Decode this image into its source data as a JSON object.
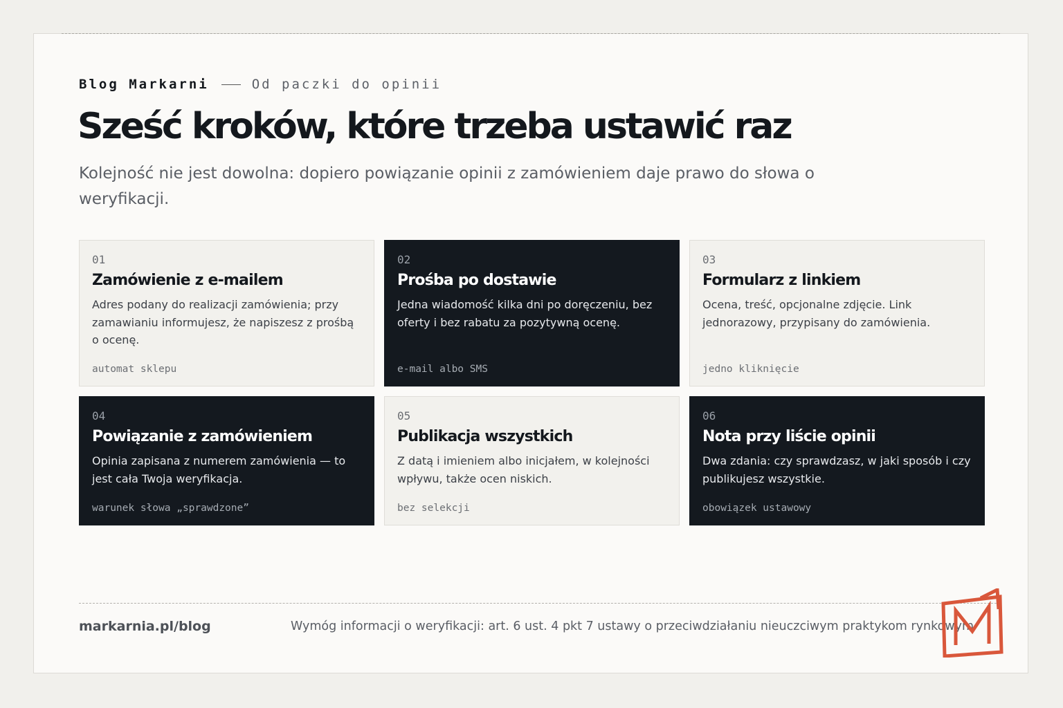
{
  "header": {
    "brand": "Blog Markarni",
    "series": "Od paczki do opinii"
  },
  "title": "Sześć kroków, które trzeba ustawić raz",
  "lead": "Kolejność nie jest dowolna: dopiero powiązanie opinii z zamówieniem daje prawo do słowa o weryfikacji.",
  "steps": [
    {
      "num": "01",
      "title": "Zamówienie z e-mailem",
      "desc": "Adres podany do realizacji zamówienia; przy zamawianiu informujesz, że napiszesz z prośbą o ocenę.",
      "tag": "automat sklepu",
      "theme": "light"
    },
    {
      "num": "02",
      "title": "Prośba po dostawie",
      "desc": "Jedna wiadomość kilka dni po doręczeniu, bez oferty i bez rabatu za pozytywną ocenę.",
      "tag": "e-mail albo SMS",
      "theme": "dark"
    },
    {
      "num": "03",
      "title": "Formularz z linkiem",
      "desc": "Ocena, treść, opcjonalne zdjęcie. Link jednorazowy, przypisany do zamówienia.",
      "tag": "jedno kliknięcie",
      "theme": "light"
    },
    {
      "num": "04",
      "title": "Powiązanie z zamówieniem",
      "desc": "Opinia zapisana z numerem zamówienia — to jest cała Twoja weryfikacja.",
      "tag": "warunek słowa „sprawdzone”",
      "theme": "dark"
    },
    {
      "num": "05",
      "title": "Publikacja wszystkich",
      "desc": "Z datą i imieniem albo inicjałem, w kolejności wpływu, także ocen niskich.",
      "tag": "bez selekcji",
      "theme": "light"
    },
    {
      "num": "06",
      "title": "Nota przy liście opinii",
      "desc": "Dwa zdania: czy sprawdzasz, w jaki sposób i czy publikujesz wszystkie.",
      "tag": "obowiązek ustawowy",
      "theme": "dark"
    }
  ],
  "footer": {
    "site": "markarnia.pl/blog",
    "note": "Wymóg informacji o weryfikacji: art. 6 ust. 4 pkt 7 ustawy o przeciwdziałaniu nieuczciwym praktykom rynkowym"
  },
  "colors": {
    "background": "#f1f0ec",
    "panel": "#fbfaf8",
    "card_light": "#f2f1ed",
    "card_dark": "#14191f",
    "text": "#14181d",
    "muted": "#5a5e65",
    "logo_red": "#d9573b"
  },
  "logo": {
    "icon": "markarnia-m-logo"
  }
}
